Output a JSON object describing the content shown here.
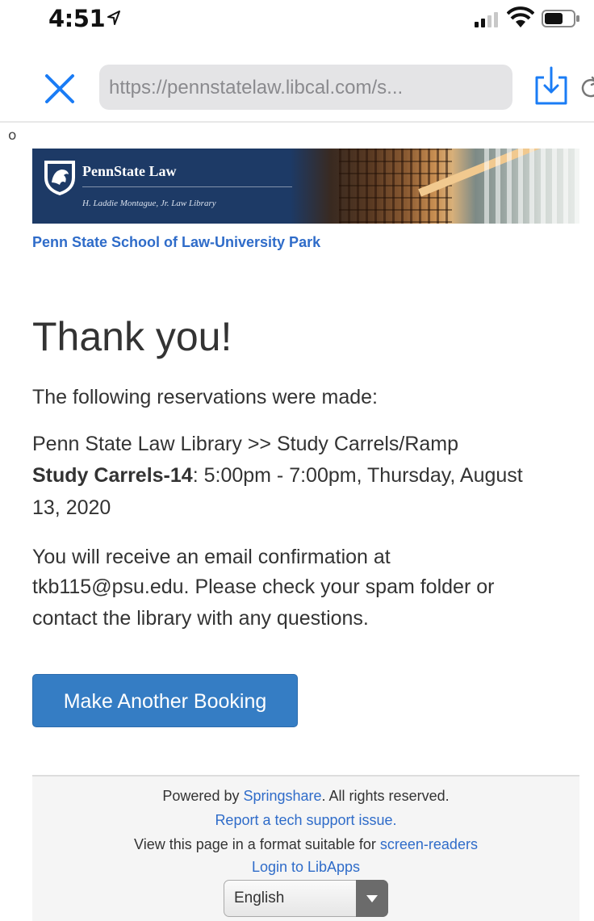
{
  "status_bar": {
    "time": "4:51",
    "icons": [
      "location-arrow-icon",
      "signal-icon",
      "wifi-icon",
      "battery-icon"
    ]
  },
  "browser": {
    "url": "https://pennstatelaw.libcal.com/s...",
    "close_icon": "close-icon",
    "reload_icon": "reload-icon",
    "share_icon": "share-icon"
  },
  "stray_char": "o",
  "banner": {
    "title": "PennState Law",
    "subtitle": "H. Laddie Montague, Jr. Law Library"
  },
  "school_link": "Penn State School of Law-University Park",
  "main": {
    "heading": "Thank you!",
    "intro": "The following reservations were made:",
    "location": "Penn State Law Library >> Study Carrels/Ramp",
    "booking_item": "Study Carrels-14",
    "booking_time_line1": ": 5:00pm - 7:00pm, Thursday, August",
    "booking_time_line2": "13, 2020",
    "confirm_line1": "You will receive an email confirmation at",
    "confirm_line2": "tkb115@psu.edu. Please check your spam folder or",
    "confirm_line3": "contact the library with any questions.",
    "button_label": "Make Another Booking"
  },
  "footer": {
    "powered_prefix": "Powered by ",
    "springshare": "Springshare",
    "powered_suffix": ". All rights reserved.",
    "report_link": "Report a tech support issue.",
    "view_prefix": "View this page in a format suitable for ",
    "screen_readers": "screen-readers",
    "login_link": "Login to LibApps",
    "language": "English"
  },
  "colors": {
    "link": "#2f6cc9",
    "button": "#357dc4",
    "banner_navy": "#1d3a66",
    "ios_blue": "#1a7cf5"
  }
}
